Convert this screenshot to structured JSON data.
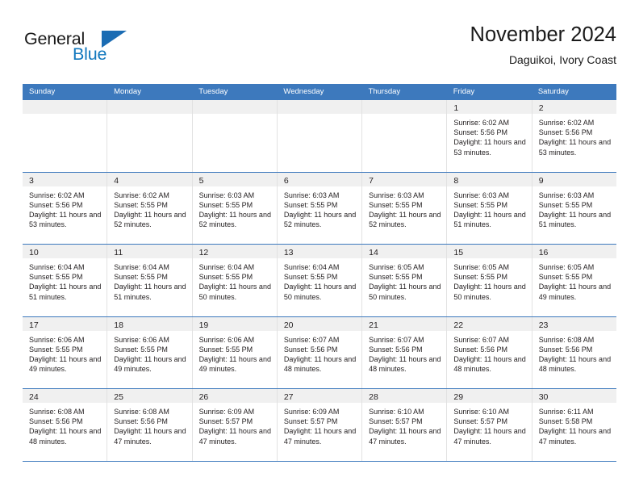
{
  "logo": {
    "word1": "General",
    "word2": "Blue",
    "triangle_color": "#1b6cb3",
    "blue_color": "#1278be"
  },
  "header": {
    "title": "November 2024",
    "subtitle": "Daguikoi, Ivory Coast"
  },
  "theme": {
    "header_blue": "#3d79bd",
    "daynum_band": "#f0f0f0",
    "cell_border": "#e2e2e2"
  },
  "weekday_headers": [
    "Sunday",
    "Monday",
    "Tuesday",
    "Wednesday",
    "Thursday",
    "Friday",
    "Saturday"
  ],
  "weeks": [
    [
      {
        "day": "",
        "empty": true
      },
      {
        "day": "",
        "empty": true
      },
      {
        "day": "",
        "empty": true
      },
      {
        "day": "",
        "empty": true
      },
      {
        "day": "",
        "empty": true
      },
      {
        "day": "1",
        "sunrise": "Sunrise: 6:02 AM",
        "sunset": "Sunset: 5:56 PM",
        "daylight": "Daylight: 11 hours and 53 minutes."
      },
      {
        "day": "2",
        "sunrise": "Sunrise: 6:02 AM",
        "sunset": "Sunset: 5:56 PM",
        "daylight": "Daylight: 11 hours and 53 minutes."
      }
    ],
    [
      {
        "day": "3",
        "sunrise": "Sunrise: 6:02 AM",
        "sunset": "Sunset: 5:56 PM",
        "daylight": "Daylight: 11 hours and 53 minutes."
      },
      {
        "day": "4",
        "sunrise": "Sunrise: 6:02 AM",
        "sunset": "Sunset: 5:55 PM",
        "daylight": "Daylight: 11 hours and 52 minutes."
      },
      {
        "day": "5",
        "sunrise": "Sunrise: 6:03 AM",
        "sunset": "Sunset: 5:55 PM",
        "daylight": "Daylight: 11 hours and 52 minutes."
      },
      {
        "day": "6",
        "sunrise": "Sunrise: 6:03 AM",
        "sunset": "Sunset: 5:55 PM",
        "daylight": "Daylight: 11 hours and 52 minutes."
      },
      {
        "day": "7",
        "sunrise": "Sunrise: 6:03 AM",
        "sunset": "Sunset: 5:55 PM",
        "daylight": "Daylight: 11 hours and 52 minutes."
      },
      {
        "day": "8",
        "sunrise": "Sunrise: 6:03 AM",
        "sunset": "Sunset: 5:55 PM",
        "daylight": "Daylight: 11 hours and 51 minutes."
      },
      {
        "day": "9",
        "sunrise": "Sunrise: 6:03 AM",
        "sunset": "Sunset: 5:55 PM",
        "daylight": "Daylight: 11 hours and 51 minutes."
      }
    ],
    [
      {
        "day": "10",
        "sunrise": "Sunrise: 6:04 AM",
        "sunset": "Sunset: 5:55 PM",
        "daylight": "Daylight: 11 hours and 51 minutes."
      },
      {
        "day": "11",
        "sunrise": "Sunrise: 6:04 AM",
        "sunset": "Sunset: 5:55 PM",
        "daylight": "Daylight: 11 hours and 51 minutes."
      },
      {
        "day": "12",
        "sunrise": "Sunrise: 6:04 AM",
        "sunset": "Sunset: 5:55 PM",
        "daylight": "Daylight: 11 hours and 50 minutes."
      },
      {
        "day": "13",
        "sunrise": "Sunrise: 6:04 AM",
        "sunset": "Sunset: 5:55 PM",
        "daylight": "Daylight: 11 hours and 50 minutes."
      },
      {
        "day": "14",
        "sunrise": "Sunrise: 6:05 AM",
        "sunset": "Sunset: 5:55 PM",
        "daylight": "Daylight: 11 hours and 50 minutes."
      },
      {
        "day": "15",
        "sunrise": "Sunrise: 6:05 AM",
        "sunset": "Sunset: 5:55 PM",
        "daylight": "Daylight: 11 hours and 50 minutes."
      },
      {
        "day": "16",
        "sunrise": "Sunrise: 6:05 AM",
        "sunset": "Sunset: 5:55 PM",
        "daylight": "Daylight: 11 hours and 49 minutes."
      }
    ],
    [
      {
        "day": "17",
        "sunrise": "Sunrise: 6:06 AM",
        "sunset": "Sunset: 5:55 PM",
        "daylight": "Daylight: 11 hours and 49 minutes."
      },
      {
        "day": "18",
        "sunrise": "Sunrise: 6:06 AM",
        "sunset": "Sunset: 5:55 PM",
        "daylight": "Daylight: 11 hours and 49 minutes."
      },
      {
        "day": "19",
        "sunrise": "Sunrise: 6:06 AM",
        "sunset": "Sunset: 5:55 PM",
        "daylight": "Daylight: 11 hours and 49 minutes."
      },
      {
        "day": "20",
        "sunrise": "Sunrise: 6:07 AM",
        "sunset": "Sunset: 5:56 PM",
        "daylight": "Daylight: 11 hours and 48 minutes."
      },
      {
        "day": "21",
        "sunrise": "Sunrise: 6:07 AM",
        "sunset": "Sunset: 5:56 PM",
        "daylight": "Daylight: 11 hours and 48 minutes."
      },
      {
        "day": "22",
        "sunrise": "Sunrise: 6:07 AM",
        "sunset": "Sunset: 5:56 PM",
        "daylight": "Daylight: 11 hours and 48 minutes."
      },
      {
        "day": "23",
        "sunrise": "Sunrise: 6:08 AM",
        "sunset": "Sunset: 5:56 PM",
        "daylight": "Daylight: 11 hours and 48 minutes."
      }
    ],
    [
      {
        "day": "24",
        "sunrise": "Sunrise: 6:08 AM",
        "sunset": "Sunset: 5:56 PM",
        "daylight": "Daylight: 11 hours and 48 minutes."
      },
      {
        "day": "25",
        "sunrise": "Sunrise: 6:08 AM",
        "sunset": "Sunset: 5:56 PM",
        "daylight": "Daylight: 11 hours and 47 minutes."
      },
      {
        "day": "26",
        "sunrise": "Sunrise: 6:09 AM",
        "sunset": "Sunset: 5:57 PM",
        "daylight": "Daylight: 11 hours and 47 minutes."
      },
      {
        "day": "27",
        "sunrise": "Sunrise: 6:09 AM",
        "sunset": "Sunset: 5:57 PM",
        "daylight": "Daylight: 11 hours and 47 minutes."
      },
      {
        "day": "28",
        "sunrise": "Sunrise: 6:10 AM",
        "sunset": "Sunset: 5:57 PM",
        "daylight": "Daylight: 11 hours and 47 minutes."
      },
      {
        "day": "29",
        "sunrise": "Sunrise: 6:10 AM",
        "sunset": "Sunset: 5:57 PM",
        "daylight": "Daylight: 11 hours and 47 minutes."
      },
      {
        "day": "30",
        "sunrise": "Sunrise: 6:11 AM",
        "sunset": "Sunset: 5:58 PM",
        "daylight": "Daylight: 11 hours and 47 minutes."
      }
    ]
  ]
}
